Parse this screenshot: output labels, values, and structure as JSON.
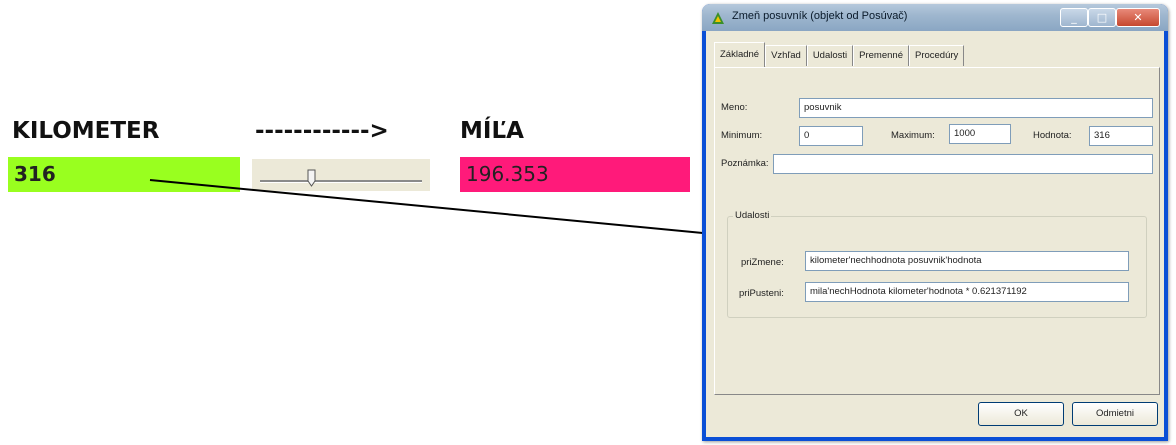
{
  "converter": {
    "km_label": "KILOMETER",
    "arrow_text": "------------>",
    "mile_label": "MÍĽA",
    "km_value": "316",
    "mile_value": "196.353",
    "slider_value": 316,
    "slider_min": 0,
    "slider_max": 1000
  },
  "colors": {
    "km_box": "#99ff1f",
    "mile_box": "#ff1a7a"
  },
  "window": {
    "title": "Zmeň posuvník (objekt od Posúvač)",
    "icon": "app-icon",
    "tabs": [
      "Základné",
      "Vzhľad",
      "Udalosti",
      "Premenné",
      "Procedúry"
    ],
    "active_tab": "Základné",
    "fields": {
      "name_label": "Meno:",
      "name_value": "posuvnik",
      "min_label": "Minimum:",
      "min_value": "0",
      "max_label": "Maximum:",
      "max_value": "1000",
      "value_label": "Hodnota:",
      "value_value": "316",
      "note_label": "Poznámka:",
      "note_value": ""
    },
    "events": {
      "legend": "Udalosti",
      "on_change_label": "priZmene:",
      "on_change_value": "kilometer'nechhodnota posuvnik'hodnota",
      "on_release_label": "priPusteni:",
      "on_release_value": "mila'nechHodnota kilometer'hodnota * 0.621371192"
    },
    "buttons": {
      "ok": "OK",
      "cancel": "Odmietni"
    }
  }
}
